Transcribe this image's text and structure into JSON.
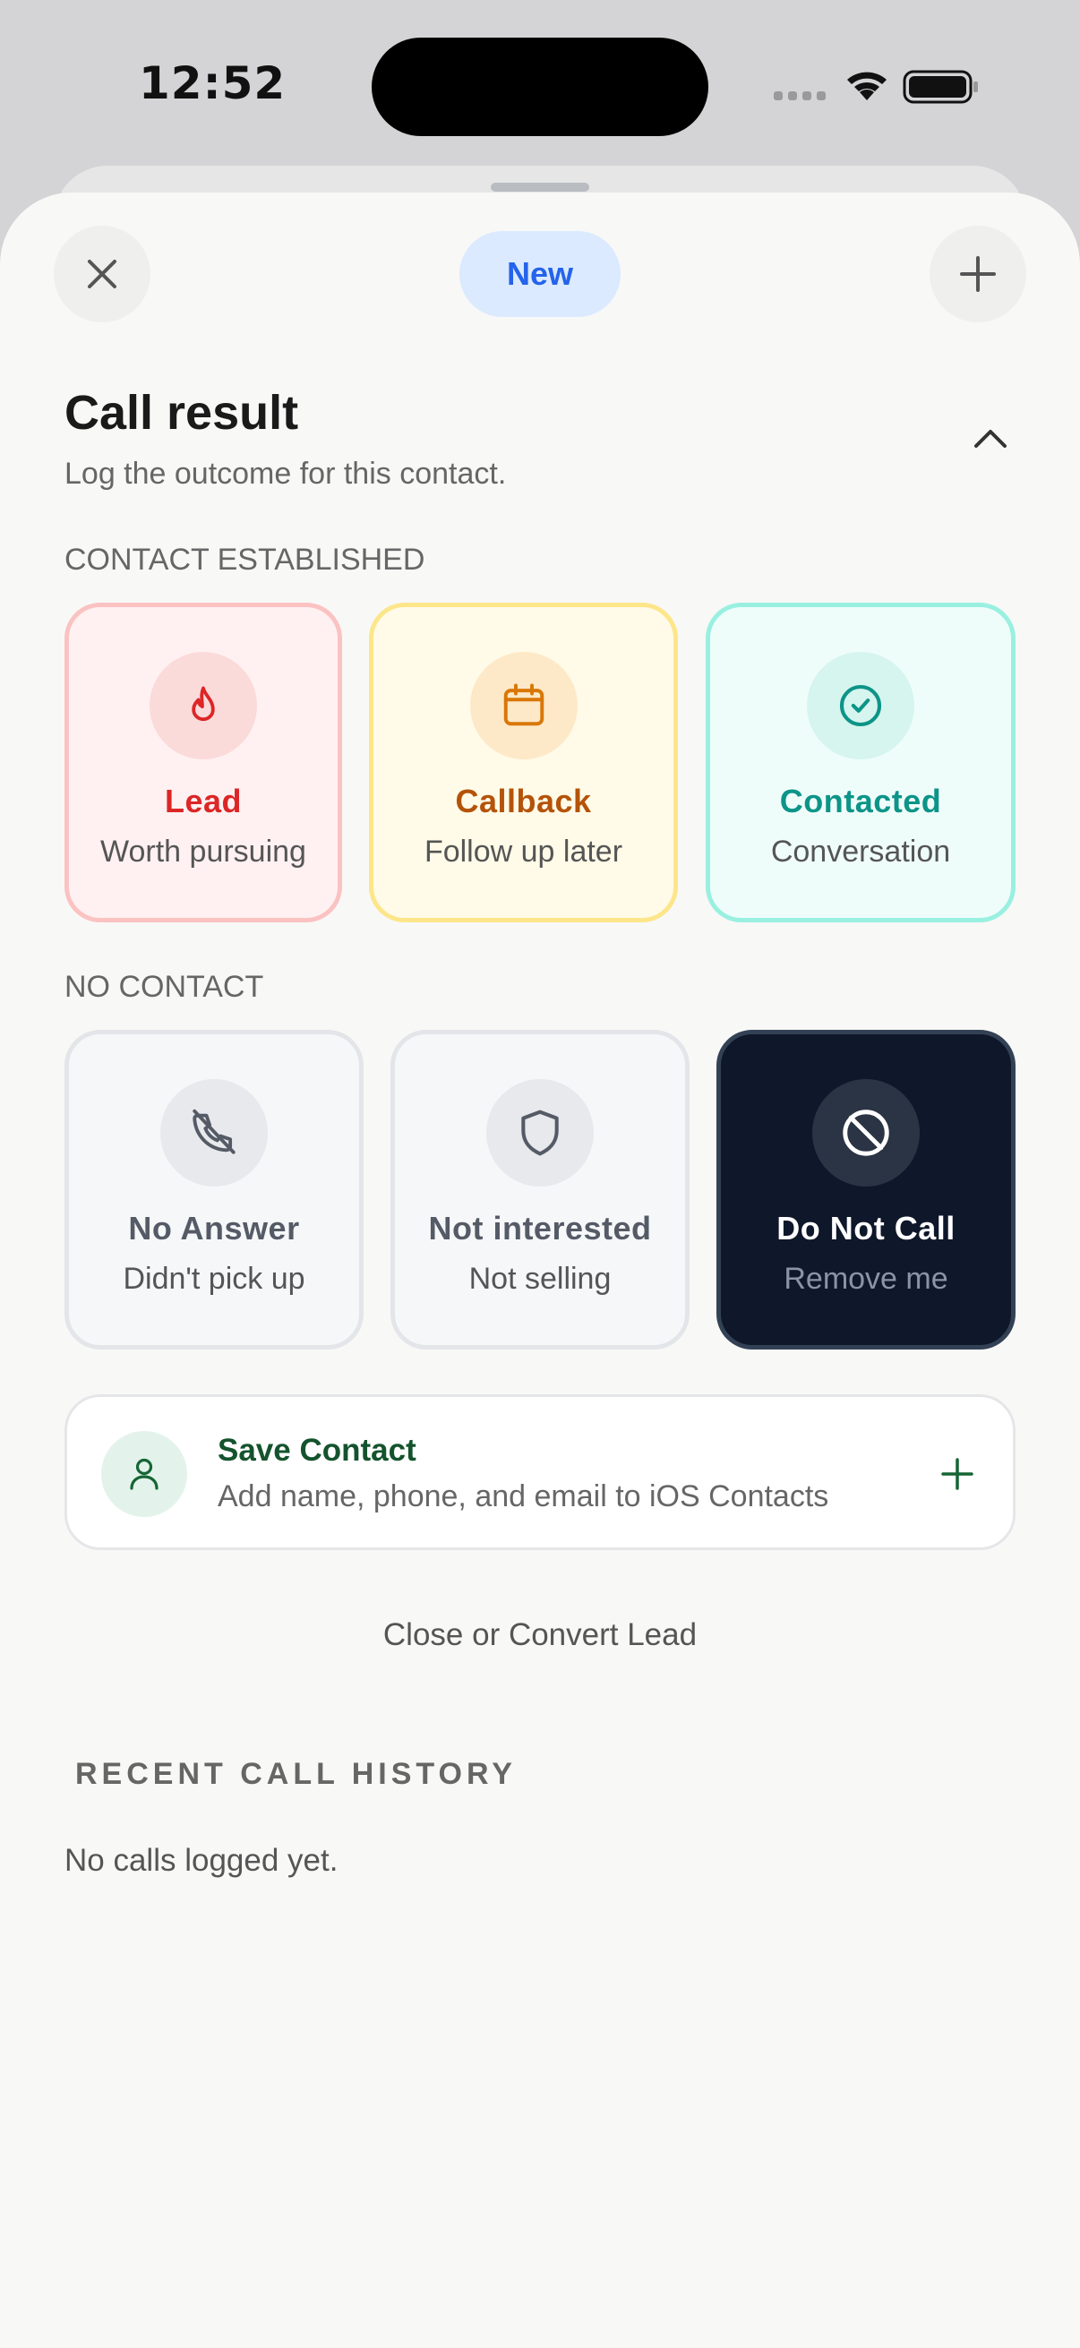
{
  "status_bar": {
    "time": "12:52"
  },
  "header": {
    "new_label": "New"
  },
  "call_result": {
    "title": "Call result",
    "subtitle": "Log the outcome for this contact."
  },
  "contact_established": {
    "label": "CONTACT ESTABLISHED",
    "options": [
      {
        "label": "Lead",
        "sub": "Worth pursuing",
        "icon": "flame-icon",
        "color": "#dc2626"
      },
      {
        "label": "Callback",
        "sub": "Follow up later",
        "icon": "calendar-icon",
        "color": "#d97706"
      },
      {
        "label": "Contacted",
        "sub": "Conversation",
        "icon": "check-circle-icon",
        "color": "#0d9488"
      }
    ]
  },
  "no_contact": {
    "label": "NO CONTACT",
    "options": [
      {
        "label": "No Answer",
        "sub": "Didn't pick up",
        "icon": "phone-missed-icon"
      },
      {
        "label": "Not interested",
        "sub": "Not selling",
        "icon": "shield-icon"
      },
      {
        "label": "Do Not Call",
        "sub": "Remove me",
        "icon": "ban-icon",
        "selected": true
      }
    ]
  },
  "save_contact": {
    "title": "Save Contact",
    "subtitle": "Add name, phone, and email to iOS Contacts"
  },
  "convert_label": "Close or Convert Lead",
  "history": {
    "title": "RECENT CALL HISTORY",
    "empty": "No calls logged yet."
  }
}
